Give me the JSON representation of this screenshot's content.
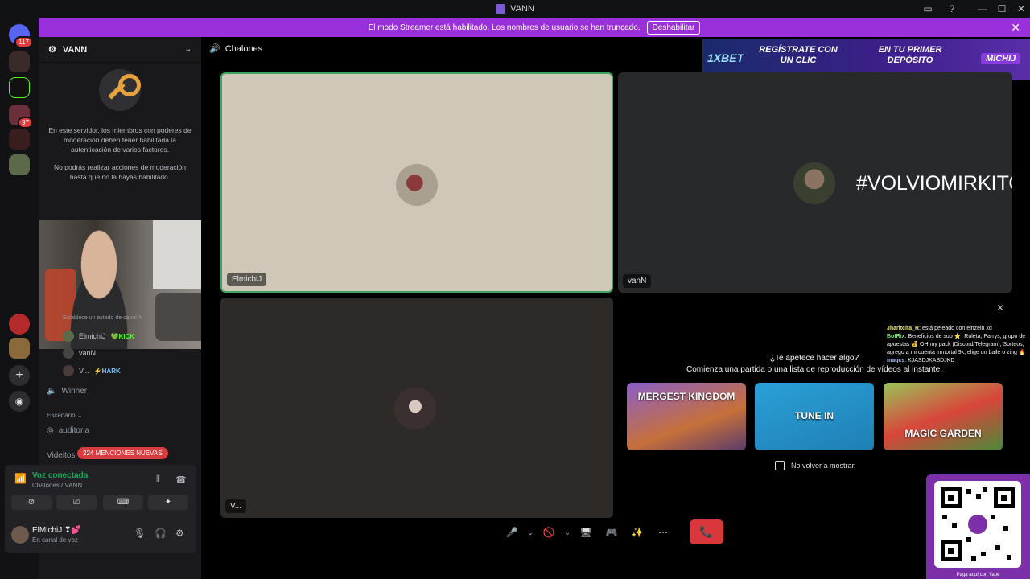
{
  "titlebar": {
    "title": "VANN",
    "controls": [
      "▭",
      "?",
      "—",
      "☐",
      "✕"
    ]
  },
  "streamer_banner": {
    "text": "El modo Streamer está habilitado. Los nombres de usuario se han truncado.",
    "button": "Deshabilitar",
    "close": "✕"
  },
  "servers": {
    "top_badge": "117",
    "badge_2": "97"
  },
  "guild": {
    "name": "VANN",
    "chevron": "⌄"
  },
  "mfa_notice": {
    "line1": "En este servidor, los miembros con poderes de moderación deben tener habilitada la autenticación de varios factores.",
    "line2": "No podrás realizar acciones de moderación hasta que no la hayas habilitado."
  },
  "channel_status_hint": "Establece un estado de canal ✎",
  "voice_members": [
    {
      "name": "ElmichiJ",
      "tag": "💚KICK"
    },
    {
      "name": "vanN",
      "tag": ""
    },
    {
      "name": "V...",
      "tag": "⚡HARK"
    }
  ],
  "channels": {
    "winner": "Winner",
    "scenario_category": "Escenario ⌄",
    "auditoria": "auditoria",
    "videitos": "Videitos"
  },
  "mentions_badge": "224 MENCIONES NUEVAS",
  "voice_panel": {
    "title": "Voz conectada",
    "subtitle": "Chalones / VANN"
  },
  "user_panel": {
    "name": "ElMichiJ ❣💕",
    "status": "En canal de voz"
  },
  "channel_header": {
    "name": "Chalones"
  },
  "ad": {
    "brand": "1XBET",
    "text1": "REGÍSTRATE CON UN CLIC",
    "text2": "EN TU PRIMER DEPÓSITO",
    "tag": "MICHIJ"
  },
  "tiles": [
    {
      "label": "ElmichiJ",
      "overlay": ""
    },
    {
      "label": "vanN",
      "overlay": "#VOLVIOMIRKITO"
    },
    {
      "label": "V...",
      "overlay": ""
    }
  ],
  "activity": {
    "close": "✕",
    "question": "¿Te apetece hacer algo?",
    "prompt": "Comienza una partida o una lista de reproducción de vídeos al instante.",
    "games": [
      {
        "name": "MERGEST KINGDOM",
        "color": "#6b4b9a"
      },
      {
        "name": "TUNE IN",
        "color": "#1c8fc8"
      },
      {
        "name": "MAGIC GARDEN",
        "color": "#4b8a3a"
      }
    ],
    "dont_show": "No volver a mostrar."
  },
  "chat_overlay": [
    {
      "user": "Jharitcita_R",
      "text": ": está peleado con einzein xd"
    },
    {
      "user": "BotRix",
      "text": ": Beneficios de sub ⭐: Ruleta, Parrys, grupo de apuestas 💰 OH my pack (Discord/Telegram), Sorteos, agrego a mi cuenta inmortal 9k, elige un baile o zing 🔥"
    },
    {
      "user": "maqcs",
      "text": ": KJASDJKASDJKD"
    }
  ],
  "call_controls": {
    "mic": "🎤",
    "camera": "🚫",
    "share": "🖥",
    "activity": "🎮",
    "soundboard": "✨",
    "more": "⋯",
    "hangup": "📞"
  },
  "qr": {
    "caption": "Paga aquí con Yape"
  }
}
